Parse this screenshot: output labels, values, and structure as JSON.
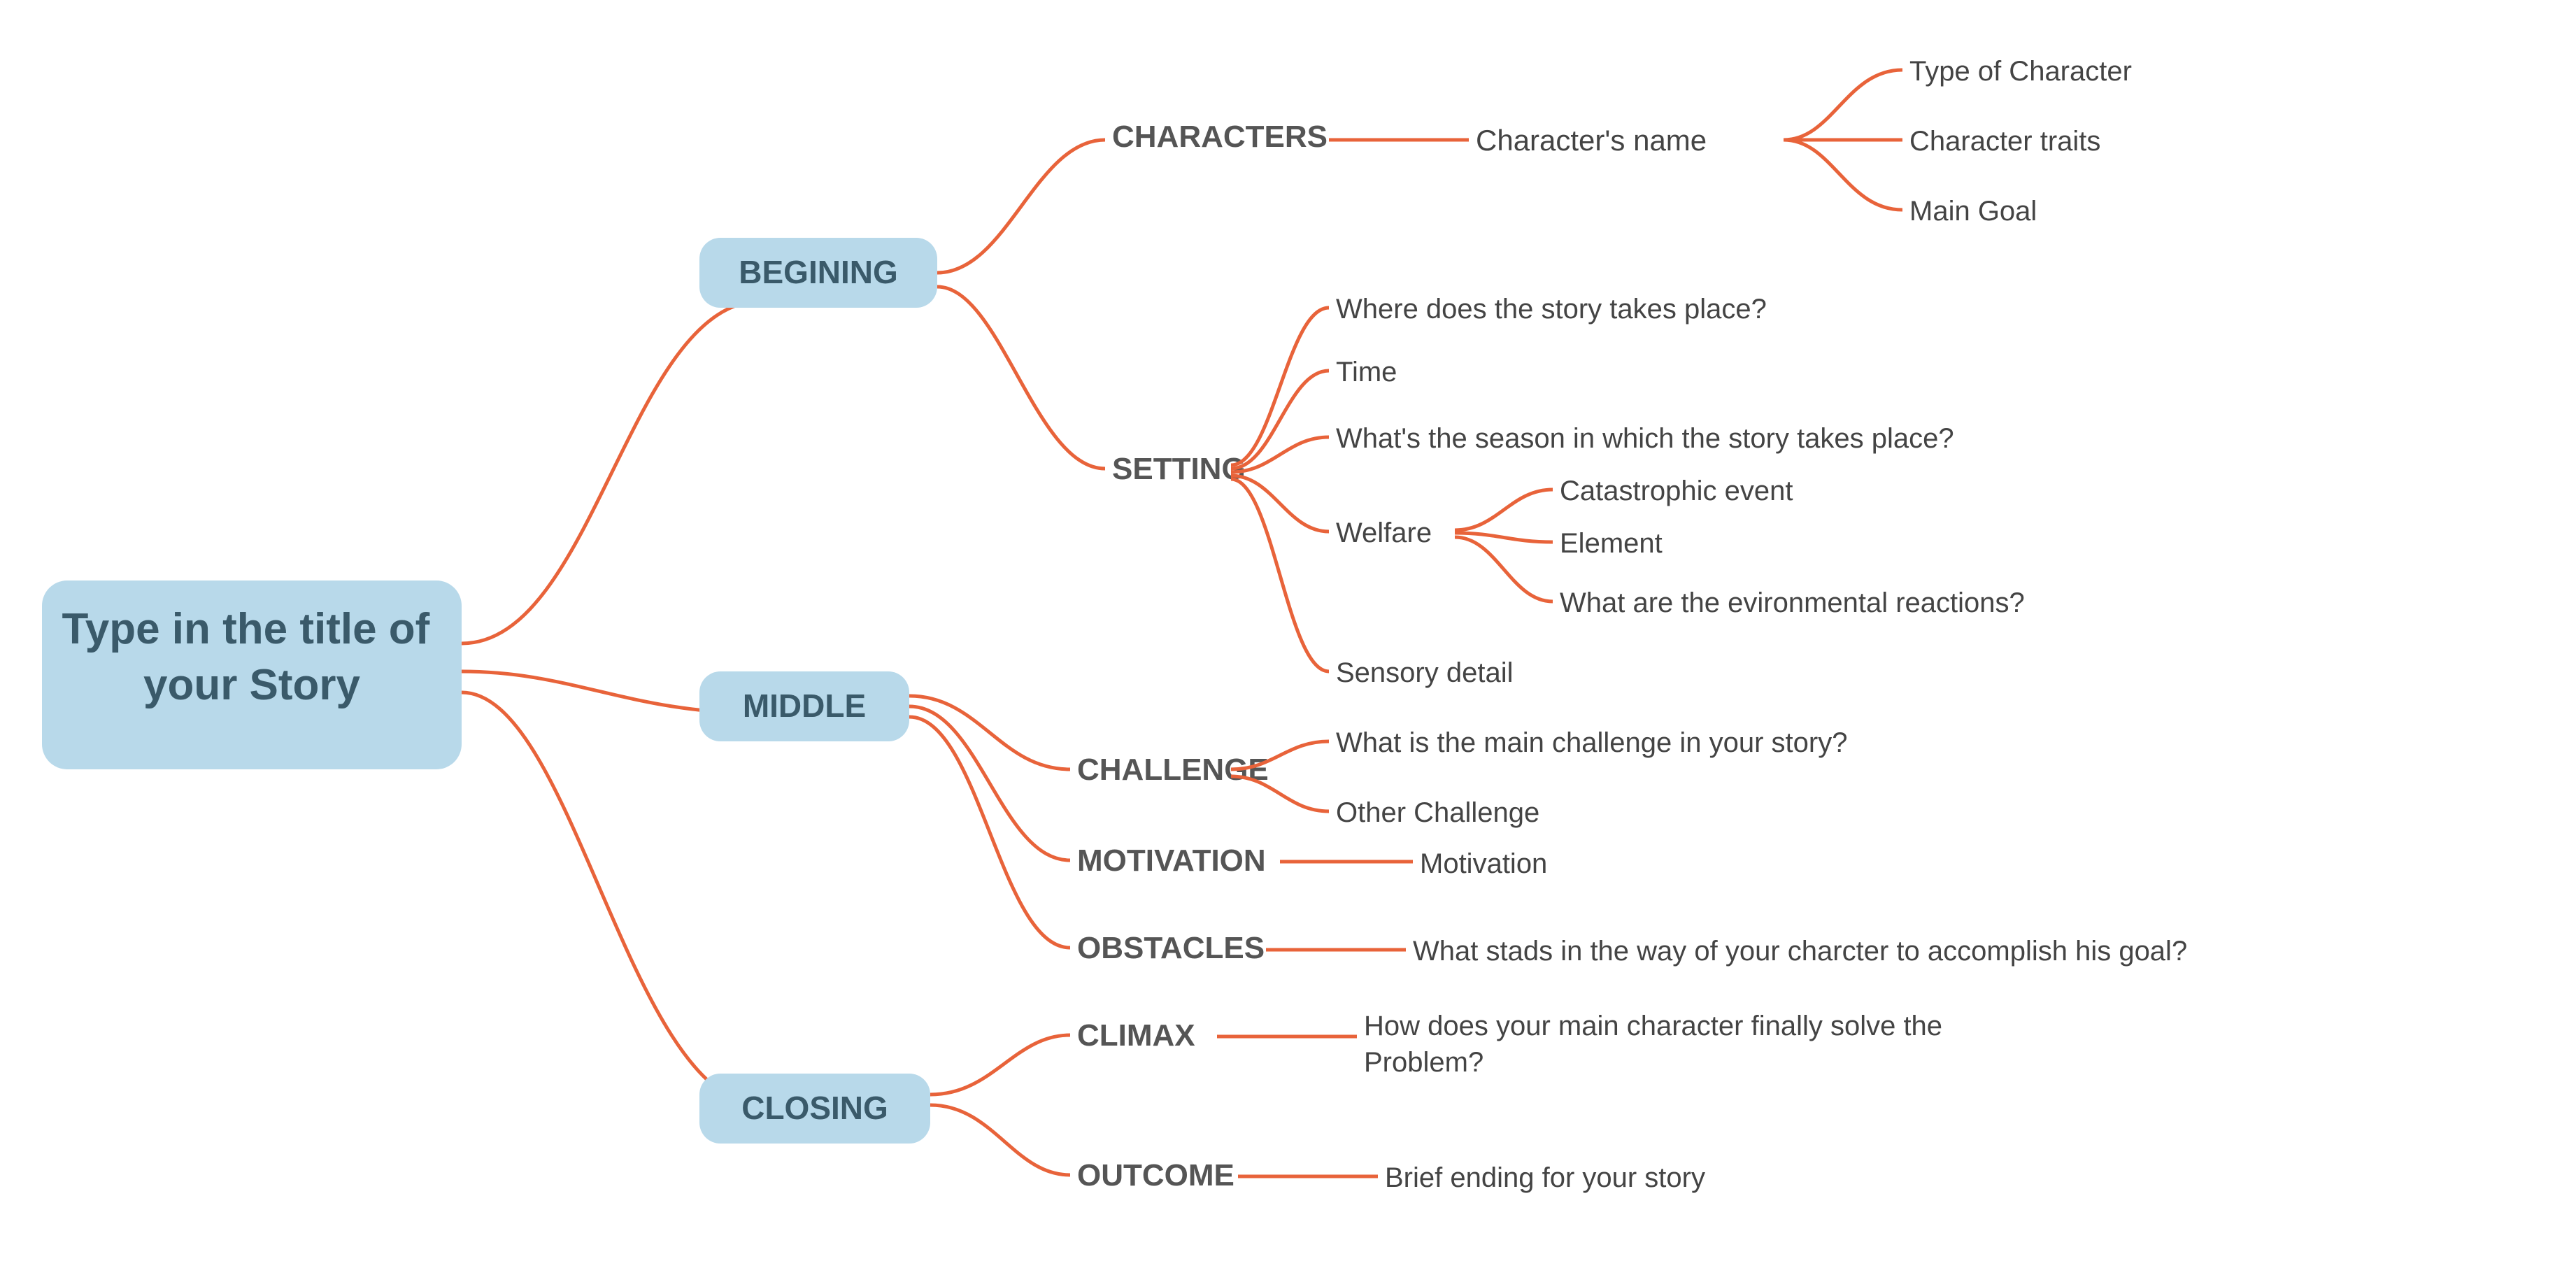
{
  "title": "Type in the title of your Story",
  "branches": [
    {
      "id": "beginning",
      "label": "BEGINING",
      "children": [
        {
          "id": "characters",
          "label": "CHARACTERS",
          "children": [
            {
              "id": "characters-name",
              "label": "Character's name",
              "children": [
                {
                  "id": "type-of-character",
                  "label": "Type of Character"
                },
                {
                  "id": "character-traits",
                  "label": "Character traits"
                },
                {
                  "id": "main-goal",
                  "label": "Main Goal"
                }
              ]
            }
          ]
        },
        {
          "id": "setting",
          "label": "SETTING",
          "children": [
            {
              "id": "where-story",
              "label": "Where does the story takes place?"
            },
            {
              "id": "time",
              "label": "Time"
            },
            {
              "id": "season",
              "label": "What's the season in which the story takes place?"
            },
            {
              "id": "welfare",
              "label": "Welfare",
              "children": [
                {
                  "id": "catastrophic",
                  "label": "Catastrophic event"
                },
                {
                  "id": "element",
                  "label": "Element"
                },
                {
                  "id": "environmental",
                  "label": "What are the evironmental reactions?"
                }
              ]
            },
            {
              "id": "sensory",
              "label": "Sensory detail"
            }
          ]
        }
      ]
    },
    {
      "id": "middle",
      "label": "MIDDLE",
      "children": [
        {
          "id": "challenge",
          "label": "CHALLENGE",
          "children": [
            {
              "id": "main-challenge",
              "label": "What is the main challenge in your story?"
            },
            {
              "id": "other-challenge",
              "label": "Other Challenge"
            }
          ]
        },
        {
          "id": "motivation",
          "label": "MOTIVATION",
          "children": [
            {
              "id": "motivation-leaf",
              "label": "Motivation"
            }
          ]
        },
        {
          "id": "obstacles",
          "label": "OBSTACLES",
          "children": [
            {
              "id": "obstacles-leaf",
              "label": "What stads in the way of your charcter to accomplish his goal?"
            }
          ]
        }
      ]
    },
    {
      "id": "closing",
      "label": "CLOSING",
      "children": [
        {
          "id": "climax",
          "label": "CLIMAX",
          "children": [
            {
              "id": "climax-leaf",
              "label": "How does your main character finally solve the Problem?"
            }
          ]
        },
        {
          "id": "outcome",
          "label": "OUTCOME",
          "children": [
            {
              "id": "outcome-leaf",
              "label": "Brief ending for your story"
            }
          ]
        }
      ]
    }
  ]
}
